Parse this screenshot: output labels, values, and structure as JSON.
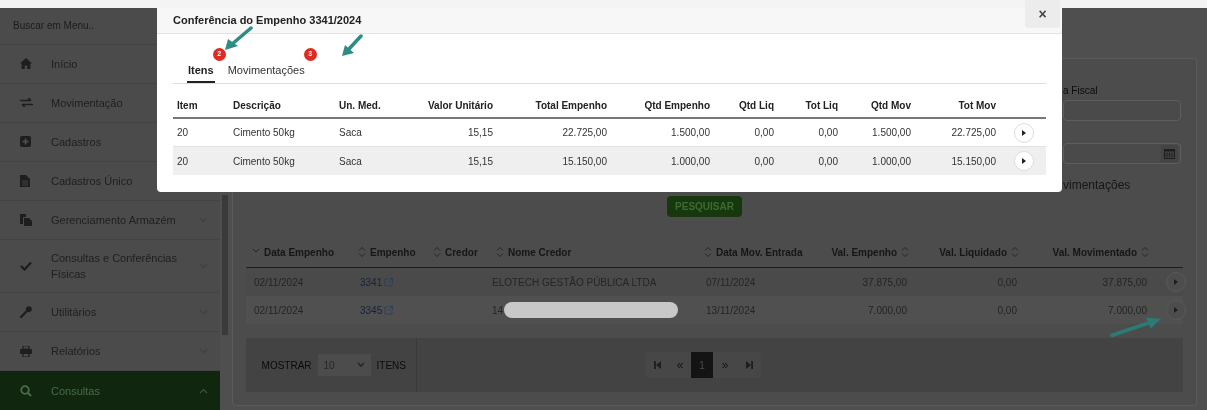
{
  "sidebar": {
    "search_placeholder": "Buscar em Menu..",
    "items": [
      {
        "label": "Início",
        "expandable": false,
        "expanded": false,
        "selected": false
      },
      {
        "label": "Movimentação",
        "expandable": false,
        "expanded": false,
        "selected": false
      },
      {
        "label": "Cadastros",
        "expandable": false,
        "expanded": false,
        "selected": false
      },
      {
        "label": "Cadastros Único",
        "expandable": false,
        "expanded": false,
        "selected": false
      },
      {
        "label": "Gerenciamento Armazém",
        "expandable": true,
        "expanded": false,
        "selected": false
      },
      {
        "label": "Consultas e Conferências Físicas",
        "expandable": true,
        "expanded": false,
        "selected": false
      },
      {
        "label": "Utilitários",
        "expandable": true,
        "expanded": false,
        "selected": false
      },
      {
        "label": "Relatórios",
        "expandable": true,
        "expanded": false,
        "selected": false
      },
      {
        "label": "Consultas",
        "expandable": true,
        "expanded": true,
        "selected": true
      }
    ]
  },
  "filters": {
    "field_label": "a Fiscal",
    "section_title": "vimentações",
    "search_button": "PESQUISAR"
  },
  "results": {
    "columns": [
      "Data Empenho",
      "Empenho",
      "Credor",
      "Nome Credor",
      "Data Mov. Entrada",
      "Val. Empenho",
      "Val. Liquidado",
      "Val. Movimentado"
    ],
    "rows": [
      {
        "data_empenho": "02/11/2024",
        "empenho": "3341",
        "nome_credor": "ELOTECH GESTÃO PÚBLICA LTDA",
        "redacted": false,
        "data_mov": "07/11/2024",
        "val_empenho": "37.875,00",
        "val_liquidado": "0,00",
        "val_movimentado": "37.875,00"
      },
      {
        "data_empenho": "02/11/2024",
        "empenho": "3345",
        "nome_credor": "14",
        "redacted": true,
        "data_mov": "13/11/2024",
        "val_empenho": "7.000,00",
        "val_liquidado": "0,00",
        "val_movimentado": "7.000,00"
      }
    ],
    "pagination": {
      "show_label": "MOSTRAR",
      "page_size": "10",
      "items_label": "ITENS",
      "prev": "«",
      "next": "»",
      "pages": [
        {
          "label": "1",
          "selected": true
        }
      ]
    }
  },
  "modal": {
    "title": "Conferência do Empenho 3341/2024",
    "close": "×",
    "tabs": [
      {
        "label": "Itens",
        "badge": "2",
        "selected": true
      },
      {
        "label": "Movimentações",
        "badge": "3",
        "selected": false
      }
    ],
    "columns": [
      "Item",
      "Descrição",
      "Un. Med.",
      "Valor Unitário",
      "Total Empenho",
      "Qtd Empenho",
      "Qtd Liq",
      "Tot Liq",
      "Qtd Mov",
      "Tot Mov"
    ],
    "rows": [
      [
        "20",
        "Cimento 50kg",
        "Saca",
        "15,15",
        "22.725,00",
        "1.500,00",
        "0,00",
        "0,00",
        "1.500,00",
        "22.725,00"
      ],
      [
        "20",
        "Cimento 50kg",
        "Saca",
        "15,15",
        "15.150,00",
        "1.000,00",
        "0,00",
        "0,00",
        "1.000,00",
        "15.150,00"
      ]
    ]
  }
}
